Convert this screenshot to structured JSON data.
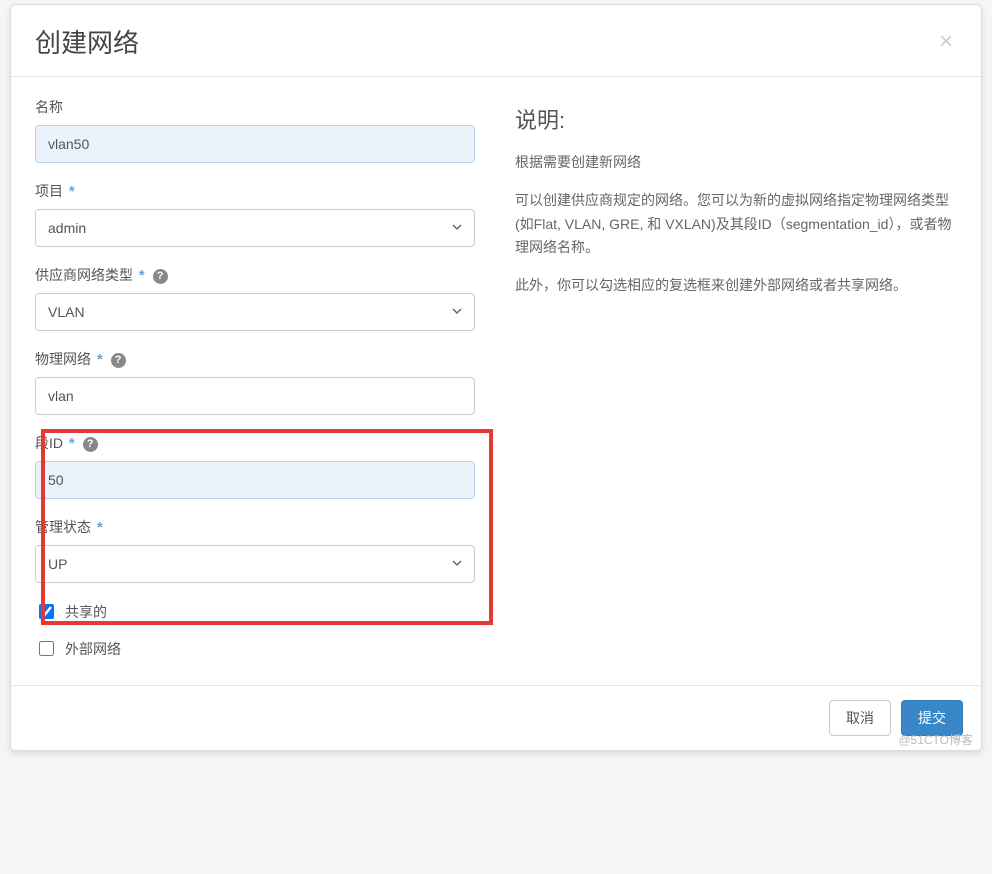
{
  "modal": {
    "title": "创建网络",
    "close_label": "×"
  },
  "form": {
    "name": {
      "label": "名称",
      "value": "vlan50"
    },
    "project": {
      "label": "项目",
      "value": "admin"
    },
    "provider_type": {
      "label": "供应商网络类型",
      "value": "VLAN"
    },
    "physical_network": {
      "label": "物理网络",
      "value": "vlan"
    },
    "segment_id": {
      "label": "段ID",
      "value": "50"
    },
    "admin_state": {
      "label": "管理状态",
      "value": "UP"
    },
    "shared": {
      "label": "共享的",
      "checked": true
    },
    "external": {
      "label": "外部网络",
      "checked": false
    }
  },
  "help": {
    "title": "说明:",
    "p1": "根据需要创建新网络",
    "p2": "可以创建供应商规定的网络。您可以为新的虚拟网络指定物理网络类型(如Flat, VLAN, GRE, 和 VXLAN)及其段ID（segmentation_id），或者物理网络名称。",
    "p3": "此外，你可以勾选相应的复选框来创建外部网络或者共享网络。"
  },
  "footer": {
    "cancel": "取消",
    "submit": "提交"
  },
  "watermark": "@51CTO博客"
}
